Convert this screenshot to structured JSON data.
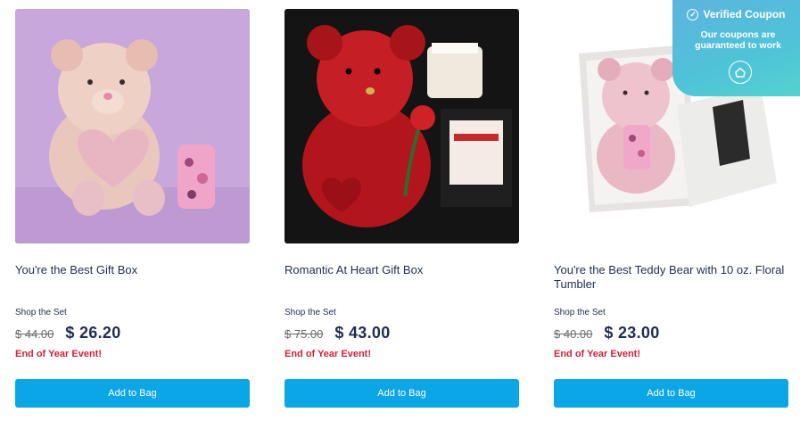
{
  "products": [
    {
      "image_alt": "pink teddy bear with floral tumbler",
      "title": "You're the Best Gift Box",
      "shop_label": "Shop the Set",
      "old_price": "$ 44.00",
      "new_price": "$ 26.20",
      "event": "End of Year Event!",
      "button": "Add to Bag"
    },
    {
      "image_alt": "red rose teddy bear with candle",
      "title": "Romantic At Heart Gift Box",
      "shop_label": "Shop the Set",
      "old_price": "$ 75.00",
      "new_price": "$ 43.00",
      "event": "End of Year Event!",
      "button": "Add to Bag"
    },
    {
      "image_alt": "pink teddy bear in gift box",
      "title": "You're the Best Teddy Bear with 10 oz. Floral Tumbler",
      "shop_label": "Shop the Set",
      "old_price": "$ 40.00",
      "new_price": "$ 23.00",
      "event": "End of Year Event!",
      "button": "Add to Bag"
    }
  ],
  "coupon_badge": {
    "title": "Verified Coupon",
    "subtitle": "Our coupons are guaranteed to work",
    "check_glyph": "✓"
  },
  "colors": {
    "button": "#0ba6e6",
    "event": "#d0213a",
    "title": "#1f2d52",
    "badge": "#4fc3d8"
  }
}
